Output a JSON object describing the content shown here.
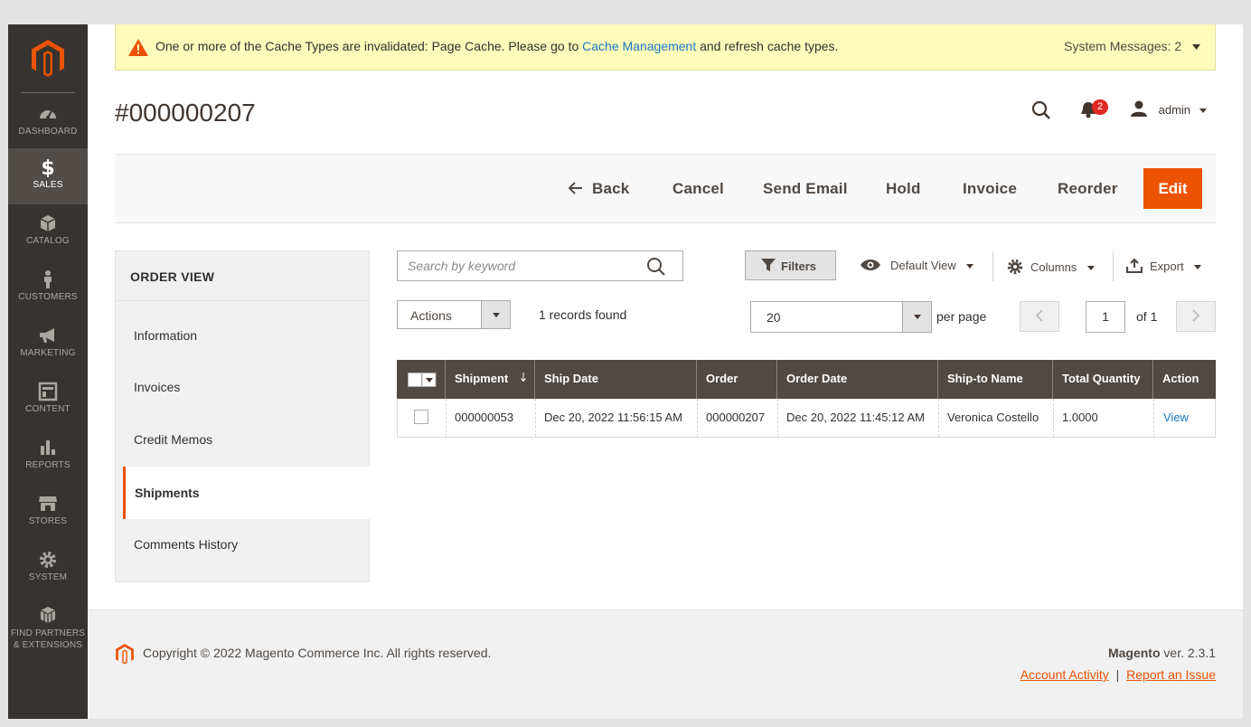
{
  "notice": {
    "message_before": "One or more of the Cache Types are invalidated: Page Cache. Please go to",
    "link": "Cache Management",
    "message_after": "and refresh cache types.",
    "system_messages": "System Messages: 2"
  },
  "sidebar": {
    "items": [
      {
        "label": "DASHBOARD",
        "icon": "dashboard-icon"
      },
      {
        "label": "SALES",
        "icon": "dollar-icon"
      },
      {
        "label": "CATALOG",
        "icon": "box-icon"
      },
      {
        "label": "CUSTOMERS",
        "icon": "person-icon"
      },
      {
        "label": "MARKETING",
        "icon": "megaphone-icon"
      },
      {
        "label": "CONTENT",
        "icon": "layout-icon"
      },
      {
        "label": "REPORTS",
        "icon": "bar-chart-icon"
      },
      {
        "label": "STORES",
        "icon": "store-icon"
      },
      {
        "label": "SYSTEM",
        "icon": "gear-icon"
      },
      {
        "label_line1": "FIND PARTNERS",
        "label_line2": "& EXTENSIONS",
        "icon": "boxes-icon"
      }
    ]
  },
  "header": {
    "title": "#000000207",
    "notifications_count": "2",
    "user": "admin"
  },
  "toolbar": {
    "back": "Back",
    "cancel": "Cancel",
    "send_email": "Send Email",
    "hold": "Hold",
    "invoice": "Invoice",
    "reorder": "Reorder",
    "edit": "Edit"
  },
  "order_nav": {
    "title": "ORDER VIEW",
    "items": [
      "Information",
      "Invoices",
      "Credit Memos",
      "Shipments",
      "Comments History"
    ],
    "active": "Shipments"
  },
  "grid_controls": {
    "search_placeholder": "Search by keyword",
    "filters": "Filters",
    "view": "Default View",
    "columns": "Columns",
    "export": "Export",
    "actions": "Actions",
    "records": "1 records found",
    "per_page_value": "20",
    "per_page_label": "per page",
    "page": "1",
    "of_pages": "of 1"
  },
  "grid": {
    "columns": [
      "Shipment",
      "Ship Date",
      "Order",
      "Order Date",
      "Ship-to Name",
      "Total Quantity",
      "Action"
    ],
    "rows": [
      {
        "shipment": "000000053",
        "ship_date": "Dec 20, 2022 11:56:15 AM",
        "order": "000000207",
        "order_date": "Dec 20, 2022 11:45:12 AM",
        "ship_to": "Veronica Costello",
        "qty": "1.0000",
        "action": "View"
      }
    ]
  },
  "footer": {
    "copyright": "Copyright © 2022 Magento Commerce Inc. All rights reserved.",
    "brand": "Magento",
    "version": "ver. 2.3.1",
    "account_activity": "Account Activity",
    "separator": "|",
    "report_issue": "Report an Issue"
  },
  "colors": {
    "accent": "#eb5202",
    "sidebar_bg": "#373330",
    "grid_header": "#514943",
    "link": "#1979c3"
  }
}
